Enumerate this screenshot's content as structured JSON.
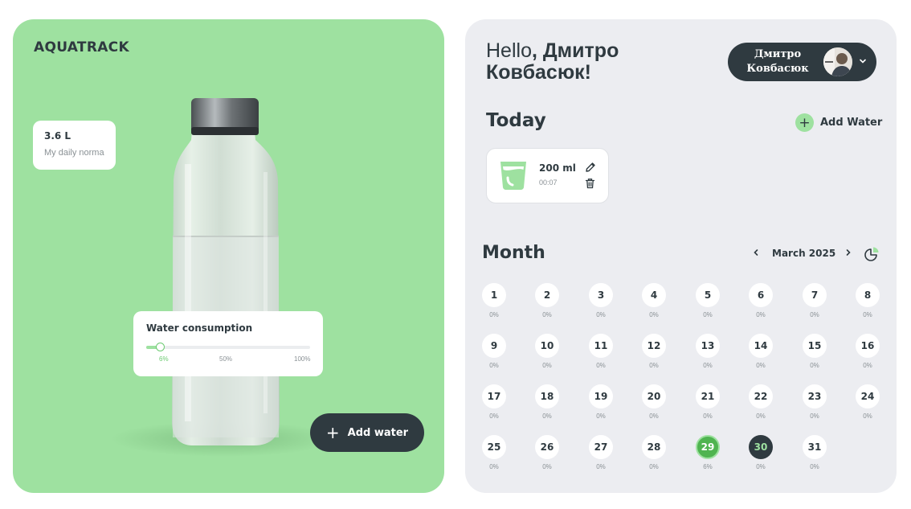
{
  "app": {
    "logo": "AQUATRACK"
  },
  "left": {
    "daily_norma": {
      "value": "3.6 L",
      "label": "My daily norma"
    },
    "consumption": {
      "title": "Water consumption",
      "progress_percent": 6,
      "ticks": [
        "6%",
        "50%",
        "100%"
      ]
    },
    "add_water_label": "Add water"
  },
  "right": {
    "greeting_prefix": "Hello",
    "greeting_name": ", Дмитро Ковбасюк!",
    "user": {
      "name": "Дмитро Ковбасюк"
    },
    "today": {
      "heading": "Today",
      "add_water_label": "Add Water",
      "entries": [
        {
          "amount": "200 ml",
          "time": "00:07"
        }
      ]
    },
    "month": {
      "heading": "Month",
      "label": "March 2025",
      "days": [
        {
          "d": "1",
          "p": "0%"
        },
        {
          "d": "2",
          "p": "0%"
        },
        {
          "d": "3",
          "p": "0%"
        },
        {
          "d": "4",
          "p": "0%"
        },
        {
          "d": "5",
          "p": "0%"
        },
        {
          "d": "6",
          "p": "0%"
        },
        {
          "d": "7",
          "p": "0%"
        },
        {
          "d": "8",
          "p": "0%"
        },
        {
          "d": "9",
          "p": "0%"
        },
        {
          "d": "10",
          "p": "0%"
        },
        {
          "d": "11",
          "p": "0%"
        },
        {
          "d": "12",
          "p": "0%"
        },
        {
          "d": "13",
          "p": "0%"
        },
        {
          "d": "14",
          "p": "0%"
        },
        {
          "d": "15",
          "p": "0%"
        },
        {
          "d": "16",
          "p": "0%"
        },
        {
          "d": "17",
          "p": "0%"
        },
        {
          "d": "18",
          "p": "0%"
        },
        {
          "d": "19",
          "p": "0%"
        },
        {
          "d": "20",
          "p": "0%"
        },
        {
          "d": "21",
          "p": "0%"
        },
        {
          "d": "22",
          "p": "0%"
        },
        {
          "d": "23",
          "p": "0%"
        },
        {
          "d": "24",
          "p": "0%"
        },
        {
          "d": "25",
          "p": "0%"
        },
        {
          "d": "26",
          "p": "0%"
        },
        {
          "d": "27",
          "p": "0%"
        },
        {
          "d": "28",
          "p": "0%"
        },
        {
          "d": "29",
          "p": "6%",
          "state": "done"
        },
        {
          "d": "30",
          "p": "0%",
          "state": "today"
        },
        {
          "d": "31",
          "p": "0%"
        }
      ]
    }
  },
  "colors": {
    "accent": "#9ee1a0",
    "dark": "#2f3a40",
    "done": "#4fb450",
    "panel": "#ecedf1"
  }
}
